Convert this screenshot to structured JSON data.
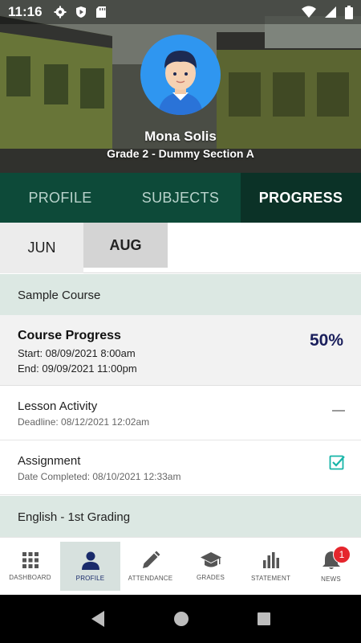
{
  "status_bar": {
    "time": "11:16"
  },
  "profile": {
    "name": "Mona  Solis",
    "section": "Grade 2 - Dummy Section A"
  },
  "tabs": [
    {
      "label": "PROFILE",
      "active": false
    },
    {
      "label": "SUBJECTS",
      "active": false
    },
    {
      "label": "PROGRESS",
      "active": true
    }
  ],
  "months": [
    {
      "label": "JUN",
      "active": false
    },
    {
      "label": "AUG",
      "active": true
    }
  ],
  "courses": [
    {
      "name": "Sample Course",
      "progress": {
        "title": "Course Progress",
        "start": "Start: 08/09/2021 8:00am",
        "end": "End: 09/09/2021 11:00pm",
        "percent": "50%"
      },
      "items": [
        {
          "title": "Lesson Activity",
          "subtitle": "Deadline: 08/12/2021 12:02am",
          "status": "pending"
        },
        {
          "title": "Assignment",
          "subtitle": "Date Completed: 08/10/2021 12:33am",
          "status": "completed"
        }
      ]
    },
    {
      "name": "English - 1st Grading"
    }
  ],
  "bottom_nav": [
    {
      "label": "DASHBOARD",
      "icon": "grid-icon",
      "active": false
    },
    {
      "label": "PROFILE",
      "icon": "person-icon",
      "active": true
    },
    {
      "label": "ATTENDANCE",
      "icon": "pencil-icon",
      "active": false
    },
    {
      "label": "GRADES",
      "icon": "graduation-cap-icon",
      "active": false
    },
    {
      "label": "STATEMENT",
      "icon": "bar-chart-icon",
      "active": false
    },
    {
      "label": "NEWS",
      "icon": "bell-icon",
      "active": false,
      "badge": "1"
    }
  ],
  "colors": {
    "primary_dark": "#0d4a39",
    "tab_active": "#0b3227",
    "course_header_bg": "#dce8e3",
    "percent_text": "#1a1f5c",
    "check_color": "#17b5a8",
    "badge": "#e5262d"
  }
}
